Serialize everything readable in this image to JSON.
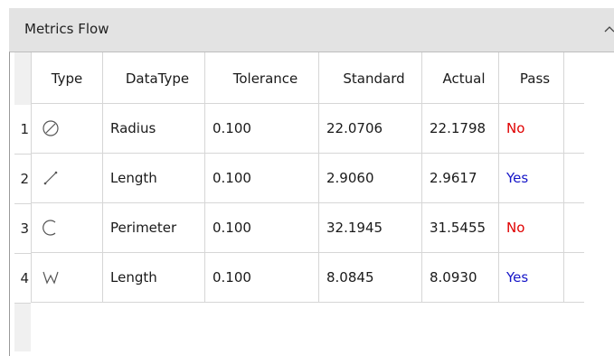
{
  "panel": {
    "title": "Metrics Flow",
    "collapse_icon": "chevron-up-icon"
  },
  "table": {
    "columns": [
      "Type",
      "DataType",
      "Tolerance",
      "Standard",
      "Actual",
      "Pass"
    ],
    "rows": [
      {
        "index": "1",
        "type_icon": "circle-diameter-icon",
        "datatype": "Radius",
        "tolerance": "0.100",
        "standard": "22.0706",
        "actual": "22.1798",
        "pass": "No"
      },
      {
        "index": "2",
        "type_icon": "line-length-icon",
        "datatype": "Length",
        "tolerance": "0.100",
        "standard": "2.9060",
        "actual": "2.9617",
        "pass": "Yes"
      },
      {
        "index": "3",
        "type_icon": "arc-perimeter-icon",
        "datatype": "Perimeter",
        "tolerance": "0.100",
        "standard": "32.1945",
        "actual": "31.5455",
        "pass": "No"
      },
      {
        "index": "4",
        "type_icon": "polyline-length-icon",
        "datatype": "Length",
        "tolerance": "0.100",
        "standard": "8.0845",
        "actual": "8.0930",
        "pass": "Yes"
      }
    ]
  },
  "colors": {
    "pass_no": "#e00000",
    "pass_yes": "#1616c8",
    "header_bg": "#e3e3e3"
  }
}
